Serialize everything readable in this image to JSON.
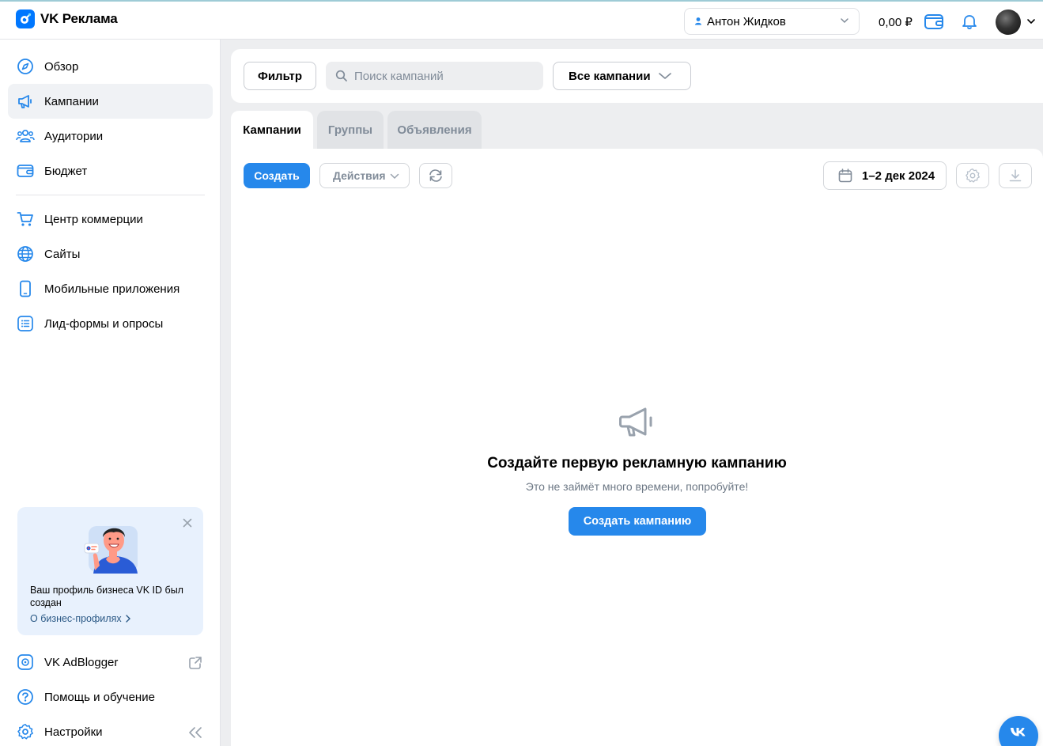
{
  "app": {
    "name": "VK Реклама"
  },
  "header": {
    "account_name": "Антон Жидков",
    "balance": "0,00 ₽"
  },
  "sidebar": {
    "items": [
      {
        "label": "Обзор",
        "icon": "compass-icon",
        "active": false
      },
      {
        "label": "Кампании",
        "icon": "megaphone-icon",
        "active": true
      },
      {
        "label": "Аудитории",
        "icon": "users-icon",
        "active": false
      },
      {
        "label": "Бюджет",
        "icon": "wallet-icon",
        "active": false
      },
      {
        "label": "Центр коммерции",
        "icon": "cart-icon",
        "active": false
      },
      {
        "label": "Сайты",
        "icon": "globe-icon",
        "active": false
      },
      {
        "label": "Мобильные приложения",
        "icon": "phone-icon",
        "active": false
      },
      {
        "label": "Лид-формы и опросы",
        "icon": "list-icon",
        "active": false
      }
    ],
    "promo": {
      "text": "Ваш профиль бизнеса VK ID был создан",
      "link": "О бизнес-профилях"
    },
    "bottom_items": [
      {
        "label": "VK AdBlogger",
        "icon": "adblogger-icon"
      },
      {
        "label": "Помощь и обучение",
        "icon": "help-icon"
      },
      {
        "label": "Настройки",
        "icon": "gear-icon"
      }
    ]
  },
  "filterbar": {
    "filter_label": "Фильтр",
    "search_placeholder": "Поиск кампаний",
    "campaign_select": "Все кампании"
  },
  "tabs": [
    {
      "label": "Кампании",
      "active": true
    },
    {
      "label": "Группы",
      "active": false
    },
    {
      "label": "Объявления",
      "active": false
    }
  ],
  "toolbar": {
    "create_label": "Создать",
    "actions_label": "Действия",
    "date_range": "1–2 дек 2024"
  },
  "empty_state": {
    "title": "Создайте первую рекламную кампанию",
    "subtitle": "Это не займёт много времени, попробуйте!",
    "cta": "Создать кампанию"
  },
  "colors": {
    "accent": "#2688eb",
    "brand": "#0077ff",
    "background": "#edeef0"
  }
}
